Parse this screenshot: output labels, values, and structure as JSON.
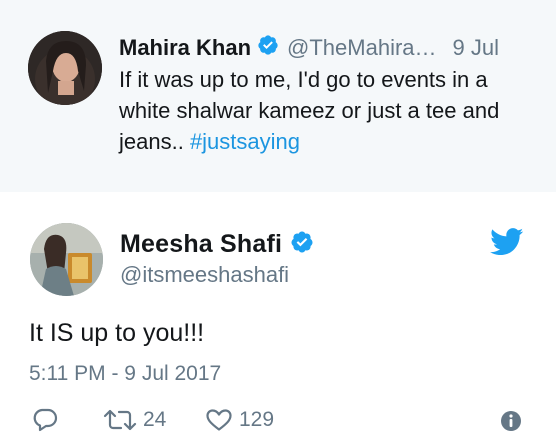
{
  "parent_tweet": {
    "name": "Mahira Khan",
    "handle": "@TheMahira…",
    "date": "9 Jul",
    "text_before": "If it was up to me, I'd go to events in a white shalwar kameez or just a tee and jeans.. ",
    "hashtag": "#justsaying",
    "verified_icon": "verified-badge-icon"
  },
  "main_tweet": {
    "name": "Meesha Shafi",
    "handle": "@itsmeeshashafi",
    "text": "It IS up to you!!!",
    "timestamp": "5:11 PM - 9 Jul 2017",
    "verified_icon": "verified-badge-icon",
    "brand_icon": "twitter-bird-icon"
  },
  "actions": {
    "reply_icon": "reply-icon",
    "retweet_icon": "retweet-icon",
    "retweet_count": "24",
    "like_icon": "heart-icon",
    "like_count": "129",
    "info_icon": "info-icon"
  },
  "colors": {
    "parent_bg": "#f5f8fa",
    "text": "#14171a",
    "muted": "#657786",
    "link": "#1b95e0",
    "twitter_blue": "#1da1f2"
  }
}
